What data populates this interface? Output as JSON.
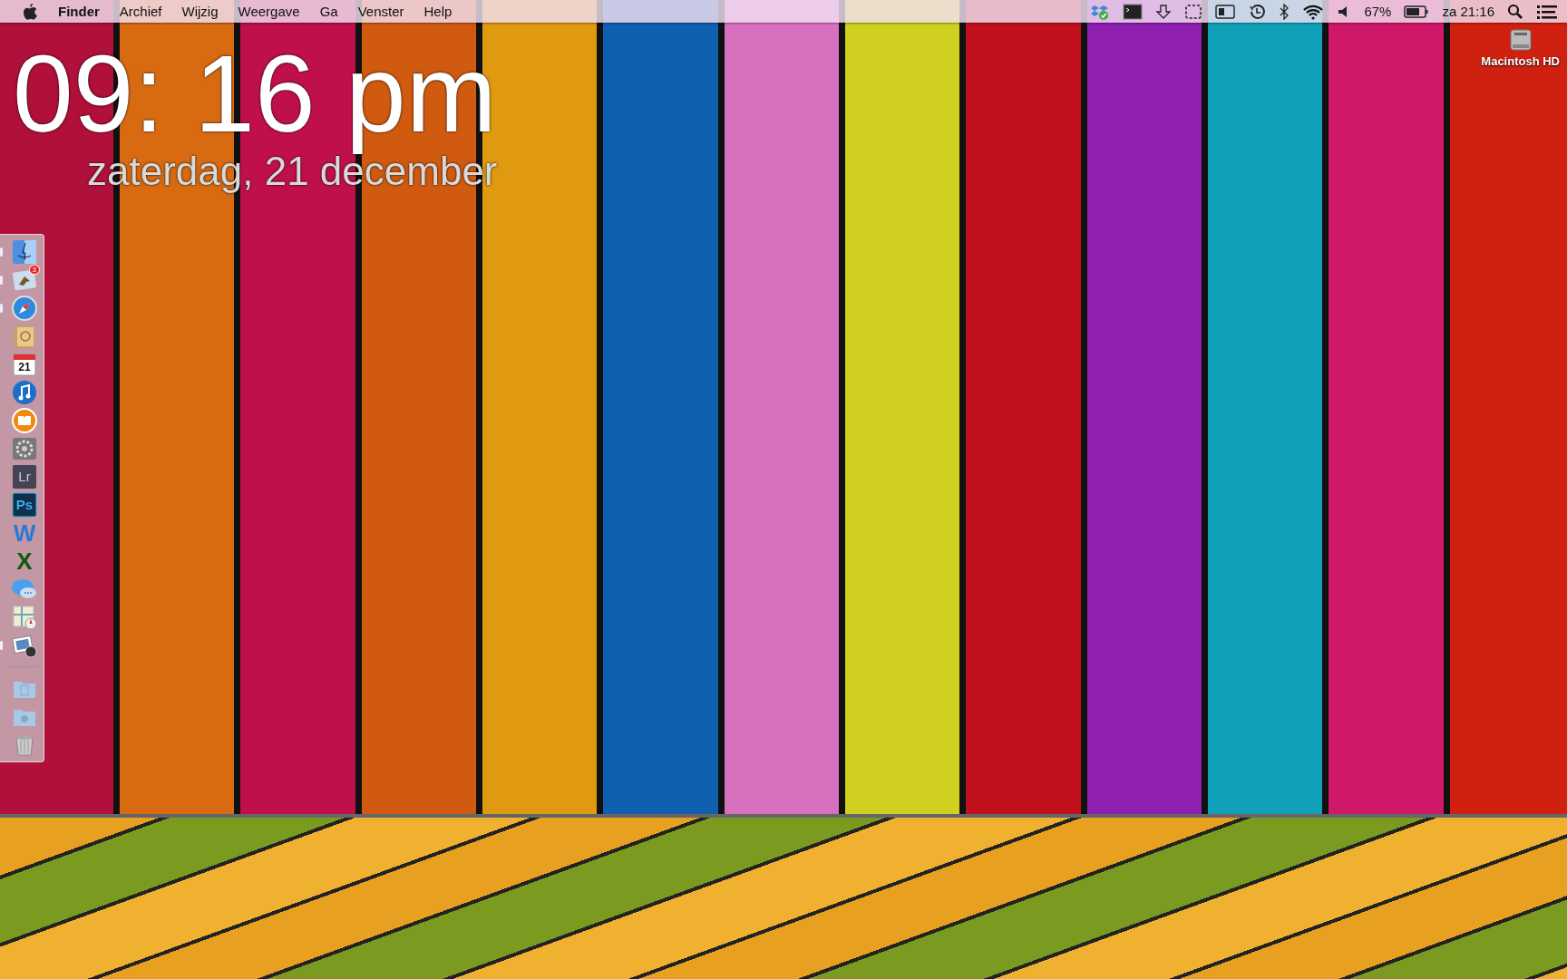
{
  "menubar": {
    "menus": [
      {
        "label": "Finder",
        "kind": "app"
      },
      {
        "label": "Archief",
        "kind": "menu"
      },
      {
        "label": "Wijzig",
        "kind": "menu"
      },
      {
        "label": "Weergave",
        "kind": "menu"
      },
      {
        "label": "Ga",
        "kind": "menu"
      },
      {
        "label": "Venster",
        "kind": "menu"
      },
      {
        "label": "Help",
        "kind": "menu"
      }
    ],
    "battery_percent": "67%",
    "clock": "za 21:16"
  },
  "desktop_clock": {
    "time": "09: 16 pm",
    "date": "zaterdag, 21 december"
  },
  "dock": {
    "items": [
      {
        "kind": "finder",
        "running": true
      },
      {
        "kind": "mail",
        "running": true,
        "badge": "3"
      },
      {
        "kind": "safari",
        "running": true
      },
      {
        "kind": "contacts",
        "running": false
      },
      {
        "kind": "calendar",
        "running": false,
        "text": "21"
      },
      {
        "kind": "music",
        "running": false
      },
      {
        "kind": "books",
        "running": false
      },
      {
        "kind": "gears",
        "running": false
      },
      {
        "kind": "lightroom",
        "running": false,
        "text": "Lr"
      },
      {
        "kind": "photoshop",
        "running": false,
        "text": "Ps"
      },
      {
        "kind": "word",
        "running": false,
        "text": "W"
      },
      {
        "kind": "excel",
        "running": false,
        "text": "X"
      },
      {
        "kind": "messages",
        "running": false
      },
      {
        "kind": "maps",
        "running": false
      },
      {
        "kind": "preview",
        "running": true
      },
      {
        "kind": "separator"
      },
      {
        "kind": "folder",
        "running": false
      },
      {
        "kind": "downloads",
        "running": false
      },
      {
        "kind": "trash",
        "running": false
      }
    ]
  },
  "desktop_icons": [
    {
      "label": "Macintosh HD"
    }
  ]
}
